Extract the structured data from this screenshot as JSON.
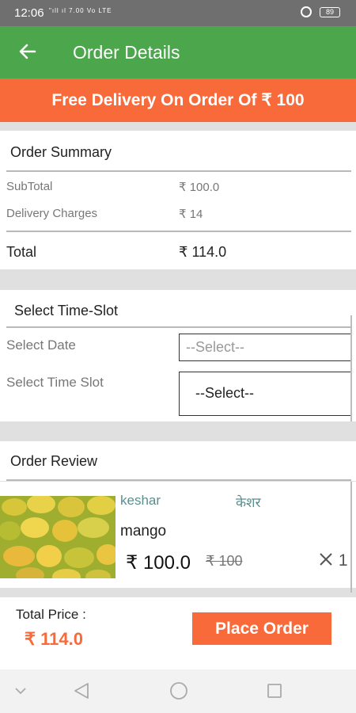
{
  "status_bar": {
    "time": "12:06",
    "signal_text": "\"ıll ıl 7.00 Vo LTE",
    "battery": "89"
  },
  "app_bar": {
    "title": "Order Details"
  },
  "promo": {
    "text": "Free Delivery On Order Of ₹ 100"
  },
  "order_summary": {
    "title": "Order Summary",
    "rows": [
      {
        "label": "SubTotal",
        "value": "₹ 100.0"
      },
      {
        "label": "Delivery Charges",
        "value": "₹ 14"
      }
    ],
    "total_label": "Total",
    "total_value": "₹ 114.0"
  },
  "time_slot": {
    "title": "Select Time-Slot",
    "date_label": "Select Date",
    "date_value": "--Select--",
    "time_label": "Select Time Slot",
    "time_value": "--Select--"
  },
  "order_review": {
    "title": "Order Review",
    "items": [
      {
        "name_en": "keshar",
        "name_local": "केशर",
        "variant": "mango",
        "price": "₹ 100.0",
        "mrp": "₹ 100",
        "qty_icon": "close-icon",
        "qty": "1"
      }
    ]
  },
  "bottom": {
    "total_label": "Total Price :",
    "total_value": "₹ 114.0",
    "place_order_label": "Place Order"
  },
  "colors": {
    "app_bar": "#4ca64c",
    "accent": "#f96a3b",
    "status_bar": "#6f6f6f"
  },
  "nav_icons": [
    "chevron-down-icon",
    "back-triangle-icon",
    "home-circle-icon",
    "recents-square-icon"
  ]
}
